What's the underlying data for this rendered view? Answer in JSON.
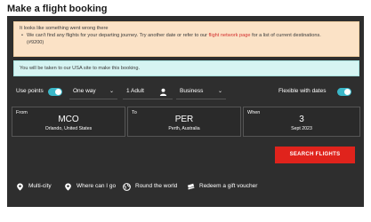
{
  "page": {
    "title": "Make a flight booking"
  },
  "alert": {
    "heading": "It looks like something went wrong there",
    "line_prefix": "We can't find any flights for your departing journey. Try another date or refer to our",
    "link_text": "flight network page",
    "line_suffix": "for a list of current destinations.",
    "code": "(#9200)"
  },
  "info": {
    "text": "You will be taken to our USA site to make this booking."
  },
  "controls": {
    "use_points_label": "Use points",
    "trip_type": "One way",
    "passengers": "1 Adult",
    "cabin": "Business",
    "flexible_label": "Flexible with dates"
  },
  "fields": {
    "from": {
      "label": "From",
      "code": "MCO",
      "city": "Orlando, United States"
    },
    "to": {
      "label": "To",
      "code": "PER",
      "city": "Perth, Australia"
    },
    "when": {
      "label": "When",
      "day": "3",
      "month": "Sept 2023"
    }
  },
  "search_button": "SEARCH FLIGHTS",
  "links": {
    "multi_city": "Multi-city",
    "where_can_i_go": "Where can I go",
    "round_the_world": "Round the world",
    "redeem_voucher": "Redeem a gift voucher"
  },
  "colors": {
    "panel": "#2e2e2e",
    "accent_red": "#e0231c",
    "toggle_on": "#3ab7c8",
    "alert_bg": "#fbe2c6",
    "info_bg": "#d6f4f2"
  },
  "icons": [
    "person-icon",
    "chevron-down-icon",
    "map-pin-icon",
    "globe-icon",
    "ticket-icon"
  ]
}
